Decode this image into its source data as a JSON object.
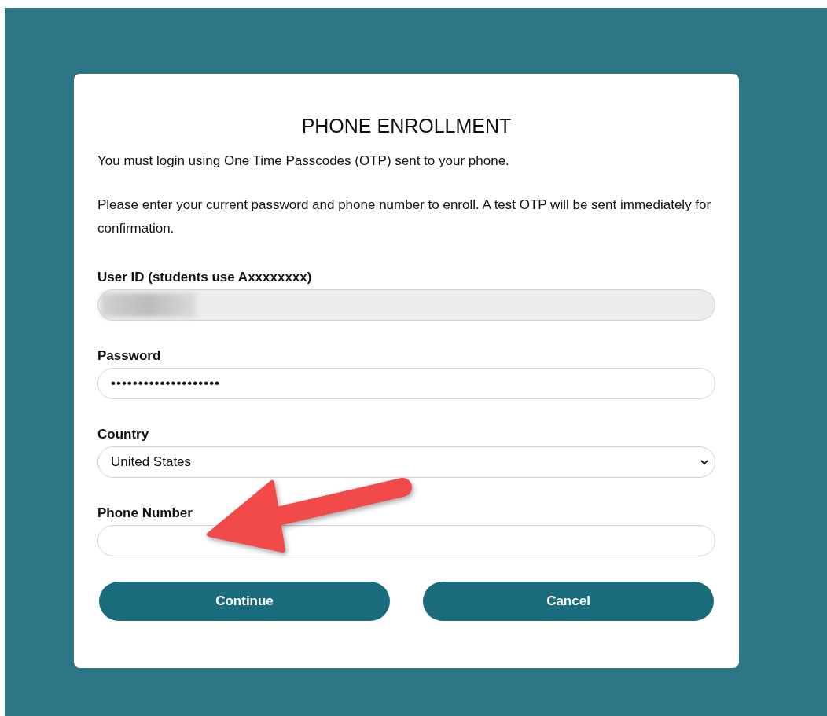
{
  "title": "PHONE ENROLLMENT",
  "intro": "You must login using One Time Passcodes (OTP) sent to your phone.",
  "instructions": "Please enter your current password and phone number to enroll. A test OTP will be sent immediately for confirmation.",
  "fields": [
    {
      "kind": "redacted",
      "label": "User ID (students use Axxxxxxxx)",
      "disabled": true
    },
    {
      "kind": "password",
      "label": "Password",
      "value": "••••••••••••••••••••",
      "disabled": false
    },
    {
      "kind": "select",
      "label": "Country",
      "value": "United States",
      "disabled": false
    },
    {
      "kind": "text",
      "label": "Phone Number",
      "disabled": false
    }
  ],
  "buttons": [
    "Continue",
    "Cancel"
  ],
  "annotation": {
    "kind": "arrow"
  }
}
